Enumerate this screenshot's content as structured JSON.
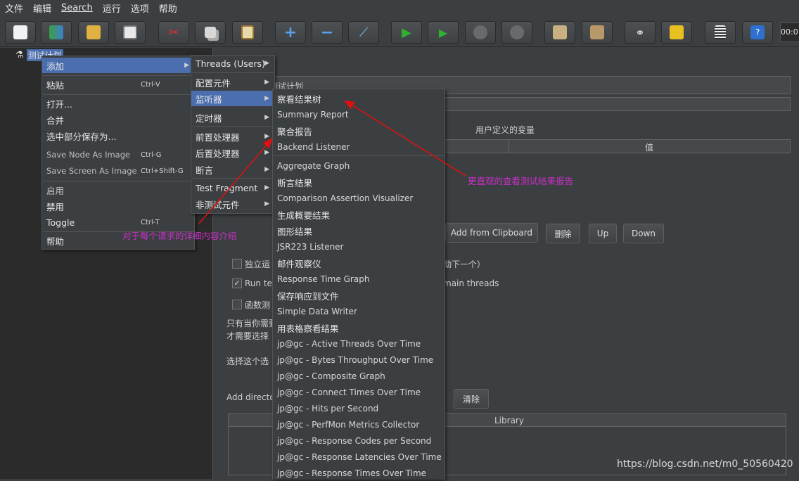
{
  "menubar": [
    "文件",
    "编辑",
    "Search",
    "运行",
    "选项",
    "帮助"
  ],
  "toolbar": {
    "timer": "00:0"
  },
  "tree": {
    "root": "测试计划"
  },
  "right": {
    "name_value": "测试计划",
    "vars_title": "用户定义的变量",
    "col_value": "值",
    "btn_add_clip": "Add from Clipboard",
    "btn_delete": "删除",
    "btn_up": "Up",
    "btn_down": "Down",
    "chk1_left": "独立运",
    "chk1_right": "动下一个）",
    "chk2_left": "Run tea",
    "chk2_right": "main threads",
    "chk3_left": "函数测",
    "note1": "只有当你需要",
    "note2": "才需要选择",
    "note3": "选择这个选",
    "add_dir": "Add directo",
    "btn_clear": "清除",
    "library": "Library"
  },
  "context_menu": {
    "items": [
      {
        "label": "添加",
        "arrow": "▶"
      },
      {
        "label": "粘贴",
        "shortcut": "Ctrl-V"
      },
      {
        "label": "打开..."
      },
      {
        "label": "合并"
      },
      {
        "label": "选中部分保存为..."
      },
      {
        "label": "Save Node As Image",
        "shortcut": "Ctrl-G"
      },
      {
        "label": "Save Screen As Image",
        "shortcut": "Ctrl+Shift-G"
      },
      {
        "label": "启用"
      },
      {
        "label": "禁用"
      },
      {
        "label": "Toggle",
        "shortcut": "Ctrl-T"
      },
      {
        "label": "帮助"
      }
    ]
  },
  "add_menu": {
    "items": [
      {
        "label": "Threads (Users)"
      },
      {
        "label": "配置元件"
      },
      {
        "label": "监听器"
      },
      {
        "label": "定时器"
      },
      {
        "label": "前置处理器"
      },
      {
        "label": "后置处理器"
      },
      {
        "label": "断言"
      },
      {
        "label": "Test Fragment"
      },
      {
        "label": "非测试元件"
      }
    ],
    "arrow": "▶"
  },
  "listener_menu": {
    "items": [
      {
        "label": "察看结果树"
      },
      {
        "label": "Summary Report"
      },
      {
        "label": "聚合报告"
      },
      {
        "label": "Backend Listener"
      },
      {
        "label": "Aggregate Graph"
      },
      {
        "label": "断言结果"
      },
      {
        "label": "Comparison Assertion Visualizer"
      },
      {
        "label": "生成概要结果"
      },
      {
        "label": "图形结果"
      },
      {
        "label": "JSR223 Listener"
      },
      {
        "label": "邮件观察仪"
      },
      {
        "label": "Response Time Graph"
      },
      {
        "label": "保存响应到文件"
      },
      {
        "label": "Simple Data Writer"
      },
      {
        "label": "用表格察看结果"
      },
      {
        "label": "jp@gc - Active Threads Over Time"
      },
      {
        "label": "jp@gc - Bytes Throughput Over Time"
      },
      {
        "label": "jp@gc - Composite Graph"
      },
      {
        "label": "jp@gc - Connect Times Over Time"
      },
      {
        "label": "jp@gc - Hits per Second"
      },
      {
        "label": "jp@gc - PerfMon Metrics Collector"
      },
      {
        "label": "jp@gc - Response Codes per Second"
      },
      {
        "label": "jp@gc - Response Latencies Over Time"
      },
      {
        "label": "jp@gc - Response Times Over Time"
      }
    ]
  },
  "annotations": {
    "detail": "对于每个请求的详细内容介绍",
    "report": "更直观的查看测试结果报告"
  },
  "watermark": "https://blog.csdn.net/m0_50560420",
  "colors": {
    "accent": "#4b6eaf",
    "annotation": "#c82fc8",
    "arrow": "#e01010"
  }
}
